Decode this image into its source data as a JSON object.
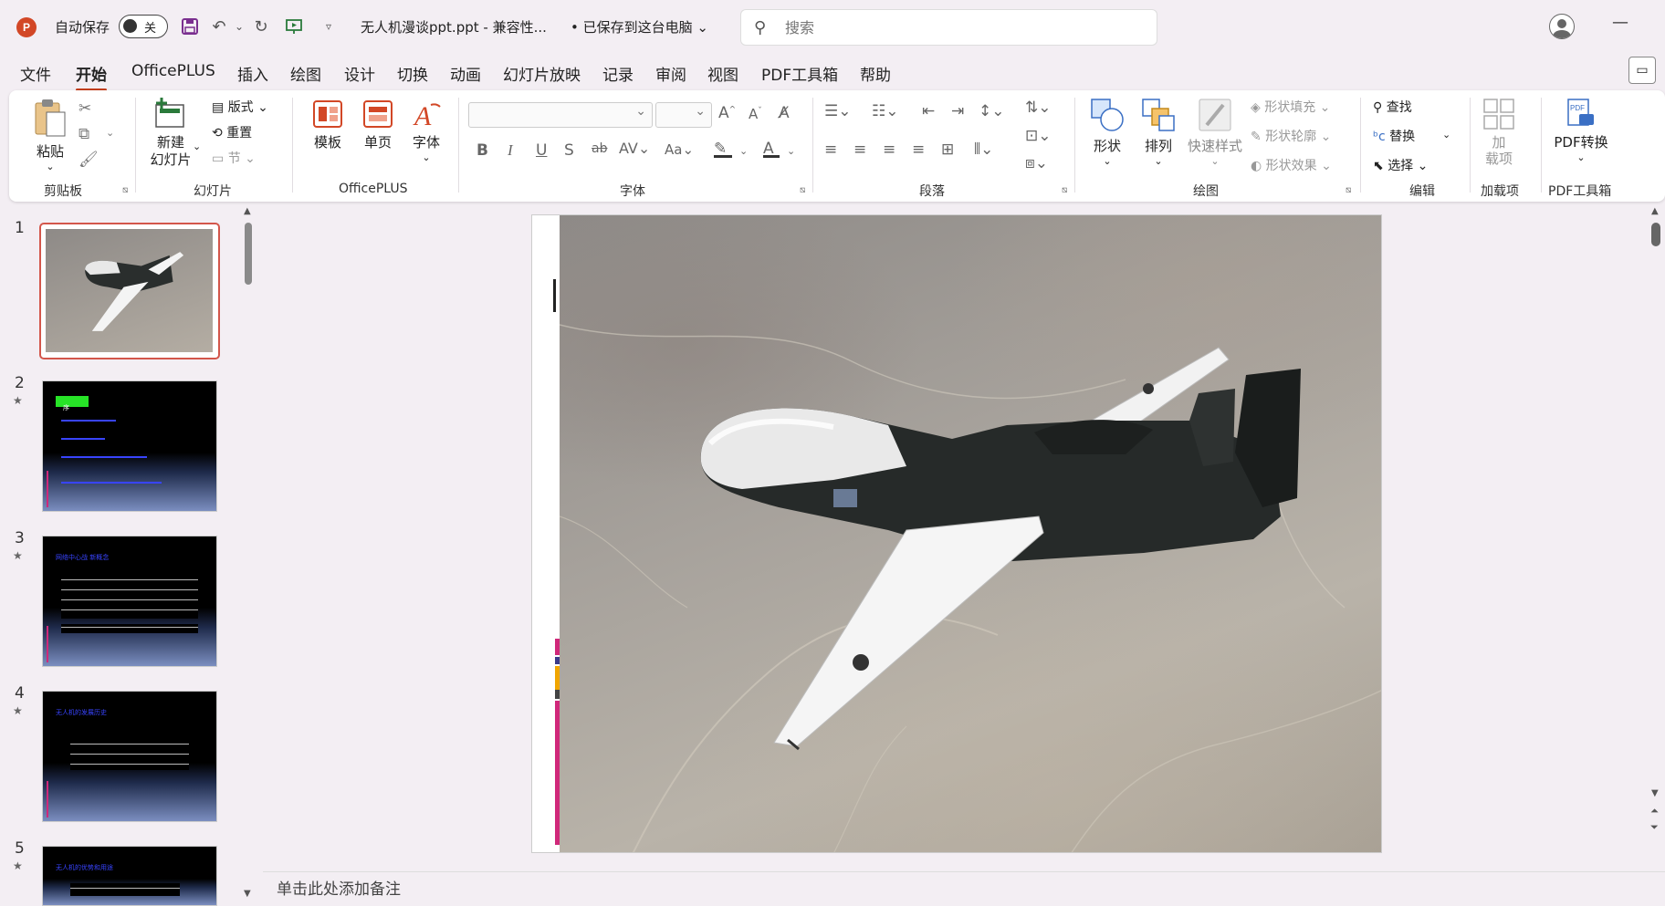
{
  "titlebar": {
    "logo": "P",
    "autosave_label": "自动保存",
    "autosave_state": "关",
    "doc_title": "无人机漫谈ppt.ppt  -  兼容性...",
    "save_state": "•  已保存到这台电脑 ⌄",
    "search_placeholder": "搜索",
    "minimize": "—"
  },
  "menu": {
    "tabs": [
      "文件",
      "开始",
      "OfficePLUS",
      "插入",
      "绘图",
      "设计",
      "切换",
      "动画",
      "幻灯片放映",
      "记录",
      "审阅",
      "视图",
      "PDF工具箱",
      "帮助"
    ],
    "active": "开始"
  },
  "ribbon": {
    "clipboard": {
      "paste": "粘贴",
      "label": "剪贴板"
    },
    "slides": {
      "new_slide": "新建\n幻灯片",
      "layout": "版式",
      "reset": "重置",
      "section": "节",
      "label": "幻灯片"
    },
    "officeplus": {
      "template": "模板",
      "single_page": "单页",
      "font": "字体",
      "label": "OfficePLUS"
    },
    "font": {
      "label": "字体"
    },
    "paragraph": {
      "label": "段落"
    },
    "drawing": {
      "shapes": "形状",
      "arrange": "排列",
      "quick_styles": "快速样式",
      "fill": "形状填充",
      "outline": "形状轮廓",
      "effects": "形状效果",
      "label": "绘图"
    },
    "editing": {
      "find": "查找",
      "replace": "替换",
      "select": "选择",
      "label": "编辑"
    },
    "addins": {
      "button": "加\n载项",
      "label": "加载项"
    },
    "pdf": {
      "button": "PDF转换",
      "label": "PDF工具箱"
    }
  },
  "slides": [
    {
      "num": "1",
      "selected": true
    },
    {
      "num": "2",
      "star": "★",
      "title": "序"
    },
    {
      "num": "3",
      "star": "★",
      "title": "网络中心战 新概念"
    },
    {
      "num": "4",
      "star": "★",
      "title": "无人机的发展历史"
    },
    {
      "num": "5",
      "star": "★",
      "title": "无人机的优势和用途"
    }
  ],
  "notes": {
    "placeholder": "单击此处添加备注"
  }
}
